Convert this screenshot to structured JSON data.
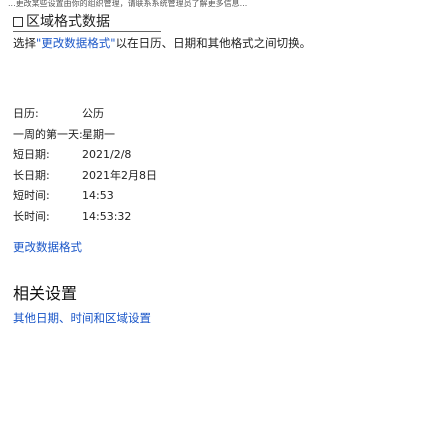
{
  "top_note": "...更改某些设置由你的组织管理，请联系系统管理员了解更多信息...",
  "section": {
    "title": "区域格式数据",
    "description_prefix": "选择",
    "description_link": "\"更改数据格式\"",
    "description_suffix": "以在日历、日期和其他格式之间切换。"
  },
  "info": [
    {
      "label": "日历:",
      "value": "公历"
    },
    {
      "label": "一周的第一天:",
      "value": "星期一"
    },
    {
      "label": "短日期:",
      "value": "2021/2/8"
    },
    {
      "label": "长日期:",
      "value": "2021年2月8日"
    },
    {
      "label": "短时间:",
      "value": "14:53"
    },
    {
      "label": "长时间:",
      "value": "14:53:32"
    }
  ],
  "change_format_link": "更改数据格式",
  "related": {
    "heading": "相关设置",
    "link_date": "其他日期",
    "separator": "、",
    "link_region": "时间和区域设置"
  }
}
